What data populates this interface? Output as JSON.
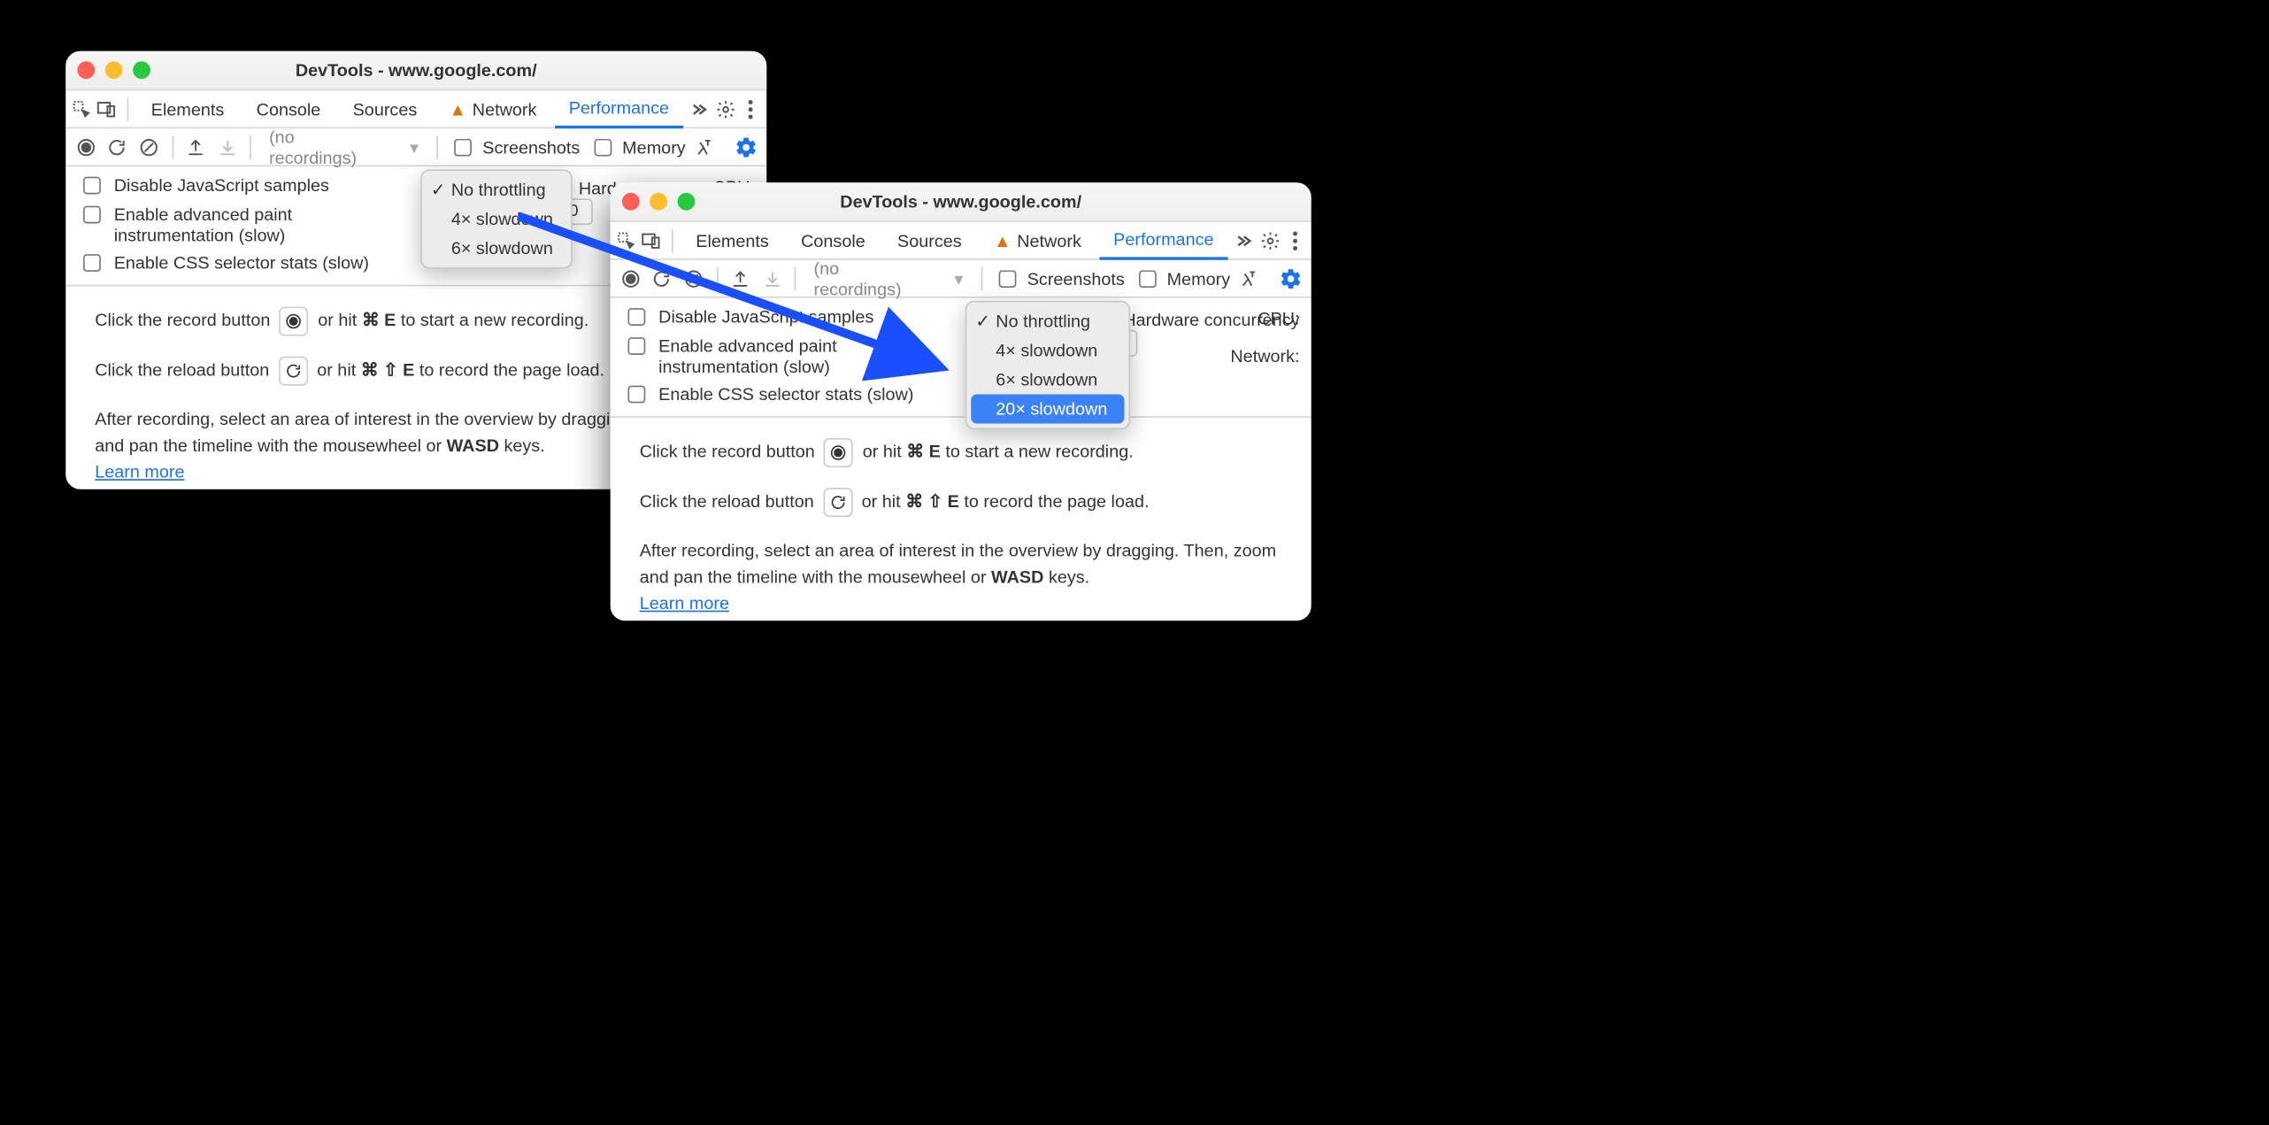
{
  "window_title": "DevTools - www.google.com/",
  "tabs": {
    "elements": "Elements",
    "console": "Console",
    "sources": "Sources",
    "network": "Network",
    "performance": "Performance"
  },
  "toolbar": {
    "no_recordings": "(no recordings)",
    "screenshots": "Screenshots",
    "memory": "Memory"
  },
  "settings": {
    "disable_js": "Disable JavaScript samples",
    "adv_paint": "Enable advanced paint instrumentation (slow)",
    "css_selector": "Enable CSS selector stats (slow)",
    "cpu_label": "CPU:",
    "network_label": "Network:",
    "hw_concurrency": "Hardware concurrency",
    "hw_value": "10"
  },
  "dropdown_a": {
    "no_throttle": "No throttling",
    "s4": "4× slowdown",
    "s6": "6× slowdown"
  },
  "dropdown_b": {
    "no_throttle": "No throttling",
    "s4": "4× slowdown",
    "s6": "6× slowdown",
    "s20": "20× slowdown"
  },
  "instructions": {
    "record_pre": "Click the record button",
    "record_post": "or hit",
    "record_key": "⌘ E",
    "record_tail": "to start a new recording.",
    "reload_pre": "Click the reload button",
    "reload_post": "or hit",
    "reload_key": "⌘ ⇧ E",
    "reload_tail": "to record the page load.",
    "after": "After recording, select an area of interest in the overview by dragging. Then, zoom and pan the timeline with the mousewheel or ",
    "wasd": "WASD",
    "keys": " keys.",
    "learn_more": "Learn more",
    "record_pre_short": "Click the record button",
    "reload_pre_short": "Click the reload button",
    "after_short": "After recording, select an area of interest in the overview by dragging. Then, zoom and pan the timeline with the mousewheel or "
  }
}
